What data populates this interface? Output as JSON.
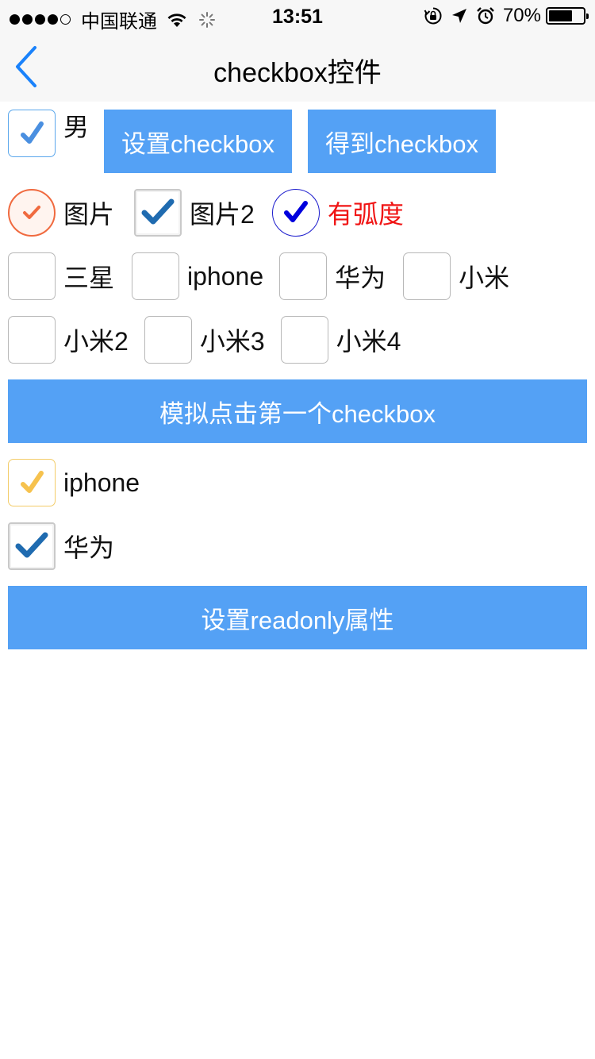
{
  "status_bar": {
    "carrier": "中国联通",
    "time": "13:51",
    "battery": "70%",
    "battery_level": 0.7
  },
  "nav": {
    "title": "checkbox控件",
    "back_icon": "chevron-left-icon"
  },
  "row1": {
    "male_label": "男",
    "set_button": "设置checkbox",
    "get_button": "得到checkbox"
  },
  "row2": {
    "image1_label": "图片",
    "image2_label": "图片2",
    "curved_label": "有弧度"
  },
  "brands": [
    {
      "label": "三星",
      "checked": false
    },
    {
      "label": "iphone",
      "checked": false
    },
    {
      "label": "华为",
      "checked": false
    },
    {
      "label": "小米",
      "checked": false
    }
  ],
  "brands2": [
    {
      "label": "小米2",
      "checked": false
    },
    {
      "label": "小米3",
      "checked": false
    },
    {
      "label": "小米4",
      "checked": false
    }
  ],
  "simulate_button": "模拟点击第一个checkbox",
  "readonly_items": [
    {
      "label": "iphone",
      "checked": true
    },
    {
      "label": "华为",
      "checked": true
    }
  ],
  "readonly_button": "设置readonly属性",
  "colors": {
    "button_bg": "#54a1f5",
    "check_blue": "#4a8fe0",
    "check_orange": "#f06a3f",
    "check_dark_blue": "#1f6bb0",
    "check_navy": "#0000dd",
    "check_yellow": "#f6c24e",
    "red_text": "#f01414"
  }
}
